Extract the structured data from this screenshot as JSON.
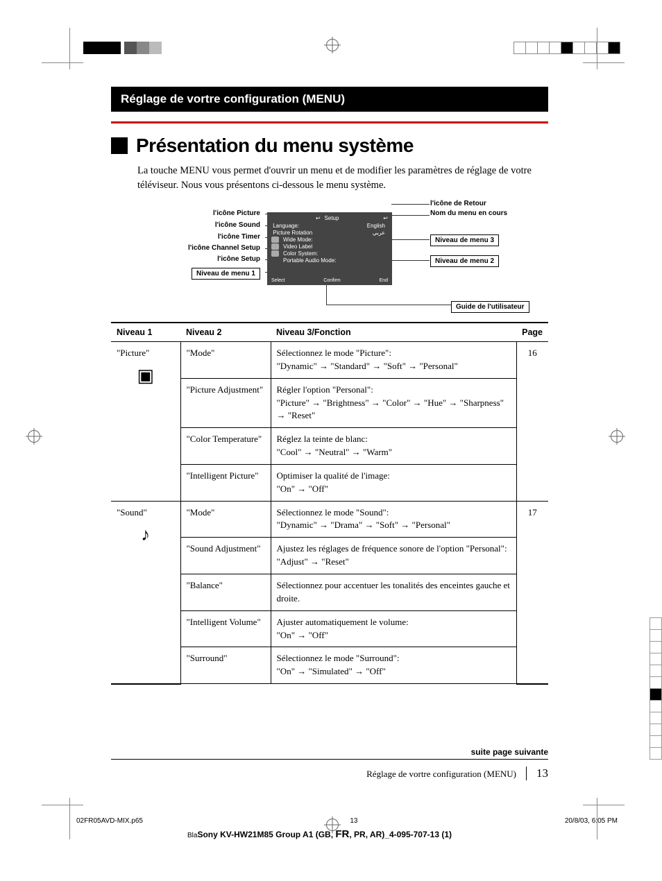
{
  "header": "Réglage de vortre configuration (MENU)",
  "title": "Présentation du menu système",
  "intro": "La touche MENU vous permet d'ouvrir un menu et de modifier les paramètres de réglage de votre téléviseur. Nous vous présentons ci-dessous le menu système.",
  "diagram": {
    "left_labels": {
      "picture": "l'icône Picture",
      "sound": "l'icône Sound",
      "timer": "l'icône Timer",
      "channel": "l'icône Channel Setup",
      "setup": "l'icône Setup",
      "level1": "Niveau de menu 1"
    },
    "right_labels": {
      "return": "l'icône de Retour",
      "current_name": "Nom du menu en cours",
      "level3": "Niveau de menu 3",
      "level2": "Niveau de menu 2",
      "guide": "Guide de l'utilisateur"
    },
    "osd": {
      "title": "Setup",
      "rows": {
        "language": "Language:",
        "language_val": "English",
        "rotation": "Picture Rotation",
        "arabic": "عربي",
        "wide": "Wide Mode:",
        "video_label": "Video Label",
        "color_system": "Color System:",
        "portable": "Portable Audio Mode:"
      },
      "footer": {
        "select": "Select",
        "confirm": "Confirm",
        "end": "End"
      }
    }
  },
  "table": {
    "headers": {
      "l1": "Niveau 1",
      "l2": "Niveau 2",
      "l3": "Niveau 3/Fonction",
      "pg": "Page"
    },
    "groups": [
      {
        "l1": "\"Picture\"",
        "icon": "picture-icon",
        "page": "16",
        "rows": [
          {
            "l2": "\"Mode\"",
            "l3": "Sélectionnez le mode \"Picture\":\n\"Dynamic\" → \"Standard\" → \"Soft\" → \"Personal\""
          },
          {
            "l2": "\"Picture Adjustment\"",
            "l3": "Régler l'option \"Personal\":\n\"Picture\" → \"Brightness\" → \"Color\" → \"Hue\" → \"Sharpness\" → \"Reset\""
          },
          {
            "l2": "\"Color Temperature\"",
            "l3": "Réglez la teinte de blanc:\n\"Cool\" → \"Neutral\" → \"Warm\""
          },
          {
            "l2": "\"Intelligent Picture\"",
            "l3": "Optimiser la qualité de l'image:\n\"On\" → \"Off\""
          }
        ]
      },
      {
        "l1": "\"Sound\"",
        "icon": "sound-icon",
        "page": "17",
        "rows": [
          {
            "l2": "\"Mode\"",
            "l3": "Sélectionnez le mode \"Sound\":\n\"Dynamic\" → \"Drama\"  → \"Soft\" → \"Personal\""
          },
          {
            "l2": "\"Sound Adjustment\"",
            "l3": "Ajustez les réglages de fréquence sonore de l'option \"Personal\":\n\"Adjust\" → \"Reset\""
          },
          {
            "l2": "\"Balance\"",
            "l3": "Sélectionnez  pour accentuer les tonalités des enceintes gauche et droite."
          },
          {
            "l2": "\"Intelligent Volume\"",
            "l3": "Ajuster automatiquement le volume:\n\"On\" → \"Off\""
          },
          {
            "l2": "\"Surround\"",
            "l3": "Sélectionnez le mode \"Surround\":\n\"On\" → \"Simulated\" → \"Off\""
          }
        ]
      }
    ]
  },
  "continue": "suite page suivante",
  "footer": {
    "text": "Réglage de vortre configuration (MENU)",
    "page": "13"
  },
  "stamp": {
    "file": "02FR05AVD-MIX.p65",
    "pg": "13",
    "dt": "20/8/03, 6:05 PM"
  },
  "stamp2": {
    "pre": "Bla",
    "main1": "Sony KV-HW21M85 Group A1 (GB",
    "sep": ", ",
    "fr": "FR",
    "main2": ", PR, AR)_4-095-707-13 (1)"
  }
}
